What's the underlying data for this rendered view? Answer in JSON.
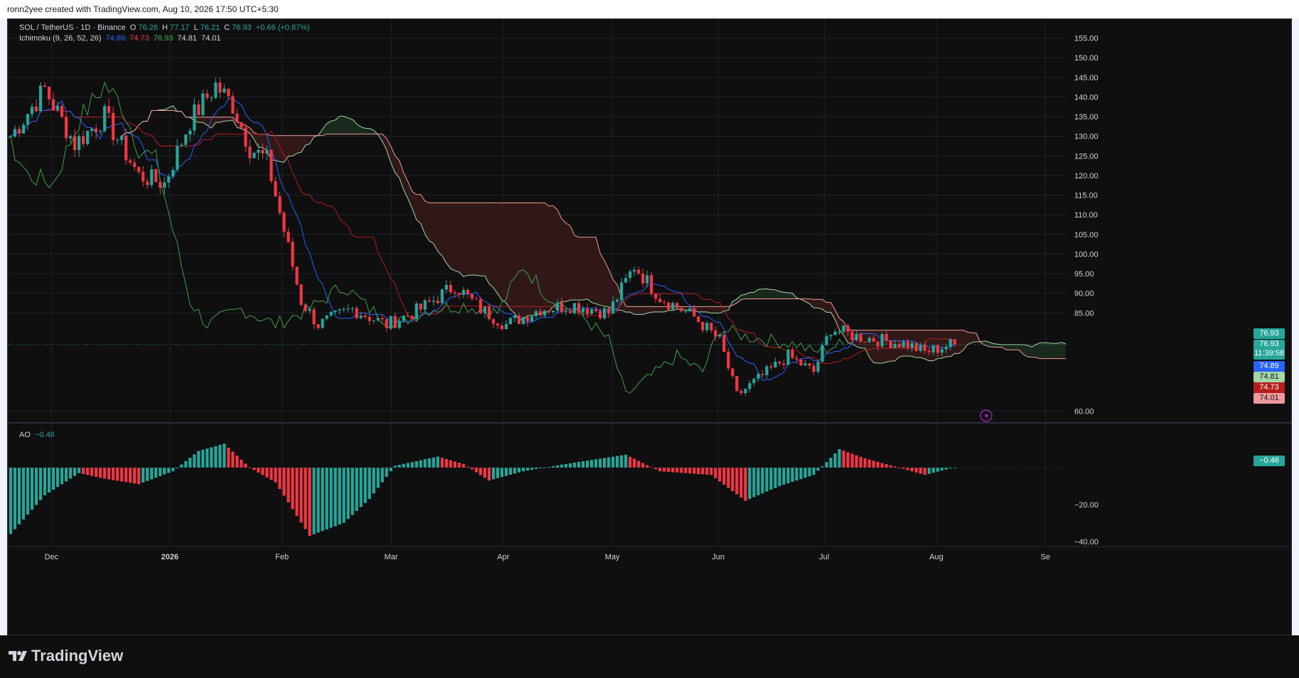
{
  "header": {
    "attribution": "ronn2yee created with TradingView.com, Aug 10, 2026 17:50 UTC+5:30"
  },
  "legend": {
    "symbol": "SOL / TetherUS · 1D · Binance",
    "o_label": "O",
    "o_value": "76.26",
    "h_label": "H",
    "h_value": "77.17",
    "l_label": "L",
    "l_value": "76.21",
    "c_label": "C",
    "c_value": "76.93",
    "change": "+0.66 (+0.87%)",
    "ichimoku_label": "Ichimoku (9, 26, 52, 26)",
    "ichimoku_values": [
      "74.89",
      "74.73",
      "76.93",
      "74.81",
      "74.01"
    ],
    "ao_label": "AO",
    "ao_value": "−0.46"
  },
  "price_tags": {
    "last": "76.93",
    "current": "76.93",
    "countdown": "11:39:58",
    "tenkan": "74.89",
    "leading_a": "74.81",
    "kijun": "74.73",
    "leading_b": "74.01",
    "ao": "−0.46"
  },
  "colors": {
    "up": "#26a69a",
    "down": "#f23645",
    "tenkan": "#2962ff",
    "kijun": "#b71c1c",
    "lagging": "#43a047",
    "span_a": "#a5d6a7",
    "span_b": "#ef9a9a",
    "cloud_bear": "#3a1a1a",
    "cloud_bull": "#1b3020"
  },
  "branding": {
    "logo_text": "TradingView"
  },
  "chart_data": [
    {
      "type": "candlestick",
      "title": "SOL / TetherUS · 1D · Binance",
      "y_ticks": [
        155,
        150,
        145,
        140,
        135,
        130,
        125,
        120,
        115,
        110,
        105,
        100,
        95,
        90,
        85,
        60
      ],
      "ylim": [
        57,
        158
      ],
      "x_labels": [
        "Dec",
        "2026",
        "Feb",
        "Mar",
        "Apr",
        "May",
        "Jun",
        "Jul",
        "Aug",
        "Se"
      ],
      "anchors": [
        {
          "i": 0,
          "v": 130
        },
        {
          "i": 8,
          "v": 142
        },
        {
          "i": 15,
          "v": 128
        },
        {
          "i": 22,
          "v": 135
        },
        {
          "i": 30,
          "v": 120
        },
        {
          "i": 36,
          "v": 118
        },
        {
          "i": 42,
          "v": 134
        },
        {
          "i": 48,
          "v": 143
        },
        {
          "i": 52,
          "v": 138
        },
        {
          "i": 56,
          "v": 127
        },
        {
          "i": 60,
          "v": 124
        },
        {
          "i": 64,
          "v": 106
        },
        {
          "i": 68,
          "v": 88
        },
        {
          "i": 72,
          "v": 82
        },
        {
          "i": 80,
          "v": 86
        },
        {
          "i": 88,
          "v": 82
        },
        {
          "i": 96,
          "v": 86
        },
        {
          "i": 104,
          "v": 92
        },
        {
          "i": 110,
          "v": 86
        },
        {
          "i": 116,
          "v": 82
        },
        {
          "i": 124,
          "v": 86
        },
        {
          "i": 132,
          "v": 87
        },
        {
          "i": 140,
          "v": 85
        },
        {
          "i": 146,
          "v": 97
        },
        {
          "i": 152,
          "v": 89
        },
        {
          "i": 160,
          "v": 84
        },
        {
          "i": 166,
          "v": 78
        },
        {
          "i": 170,
          "v": 64
        },
        {
          "i": 176,
          "v": 69
        },
        {
          "i": 182,
          "v": 74
        },
        {
          "i": 188,
          "v": 70
        },
        {
          "i": 192,
          "v": 81
        },
        {
          "i": 198,
          "v": 79
        },
        {
          "i": 204,
          "v": 78
        },
        {
          "i": 210,
          "v": 77
        },
        {
          "i": 214,
          "v": 75
        },
        {
          "i": 220,
          "v": 76.93
        }
      ],
      "indicators": {
        "tenkan": 74.89,
        "kijun": 74.73,
        "lagging": 76.93,
        "leading_a": 74.81,
        "leading_b": 74.01
      }
    },
    {
      "type": "bar",
      "title": "AO",
      "y_ticks": [
        -20,
        -40
      ],
      "ylim": [
        -42,
        15
      ],
      "anchors": [
        {
          "i": 0,
          "v": -36
        },
        {
          "i": 8,
          "v": -15
        },
        {
          "i": 16,
          "v": -3
        },
        {
          "i": 22,
          "v": -6
        },
        {
          "i": 30,
          "v": -9
        },
        {
          "i": 38,
          "v": -2
        },
        {
          "i": 44,
          "v": 9
        },
        {
          "i": 50,
          "v": 13
        },
        {
          "i": 56,
          "v": 0
        },
        {
          "i": 62,
          "v": -8
        },
        {
          "i": 70,
          "v": -37
        },
        {
          "i": 78,
          "v": -30
        },
        {
          "i": 84,
          "v": -17
        },
        {
          "i": 90,
          "v": 1
        },
        {
          "i": 100,
          "v": 6
        },
        {
          "i": 106,
          "v": 2
        },
        {
          "i": 112,
          "v": -7
        },
        {
          "i": 120,
          "v": -2
        },
        {
          "i": 130,
          "v": 2
        },
        {
          "i": 144,
          "v": 7
        },
        {
          "i": 152,
          "v": -2
        },
        {
          "i": 164,
          "v": -4
        },
        {
          "i": 172,
          "v": -18
        },
        {
          "i": 180,
          "v": -10
        },
        {
          "i": 188,
          "v": -4
        },
        {
          "i": 194,
          "v": 10
        },
        {
          "i": 200,
          "v": 5
        },
        {
          "i": 208,
          "v": 0
        },
        {
          "i": 214,
          "v": -4
        },
        {
          "i": 220,
          "v": -0.46
        }
      ]
    }
  ]
}
